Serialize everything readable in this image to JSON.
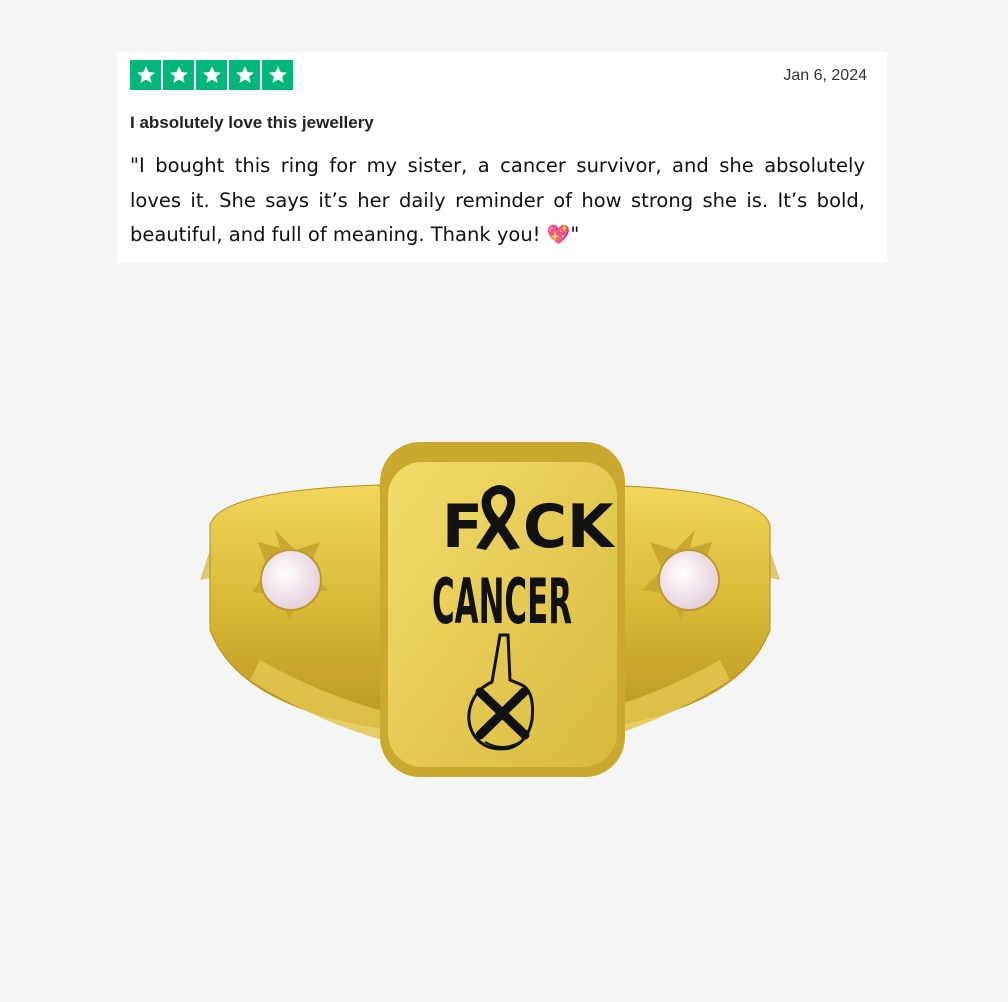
{
  "review": {
    "rating": 5,
    "rating_max": 5,
    "star_color": "#00b67a",
    "date": "Jan 6, 2024",
    "title": "I absolutely love this jewellery",
    "body": "\"I bought this ring for my sister, a cancer survivor, and she absolutely loves it. She says it’s her daily reminder of how strong she is. It’s bold, beautiful, and full of meaning. Thank you! ",
    "emoji": "💖",
    "body_end": "\""
  },
  "product": {
    "engraving_line1": "F",
    "engraving_line1_end": "CK",
    "engraving_line2": "CANCER",
    "metal_color": "#d9b836",
    "gem_color": "#f3e4ec",
    "icons": [
      "awareness-ribbon-icon",
      "skeleton-hand-icon"
    ]
  }
}
